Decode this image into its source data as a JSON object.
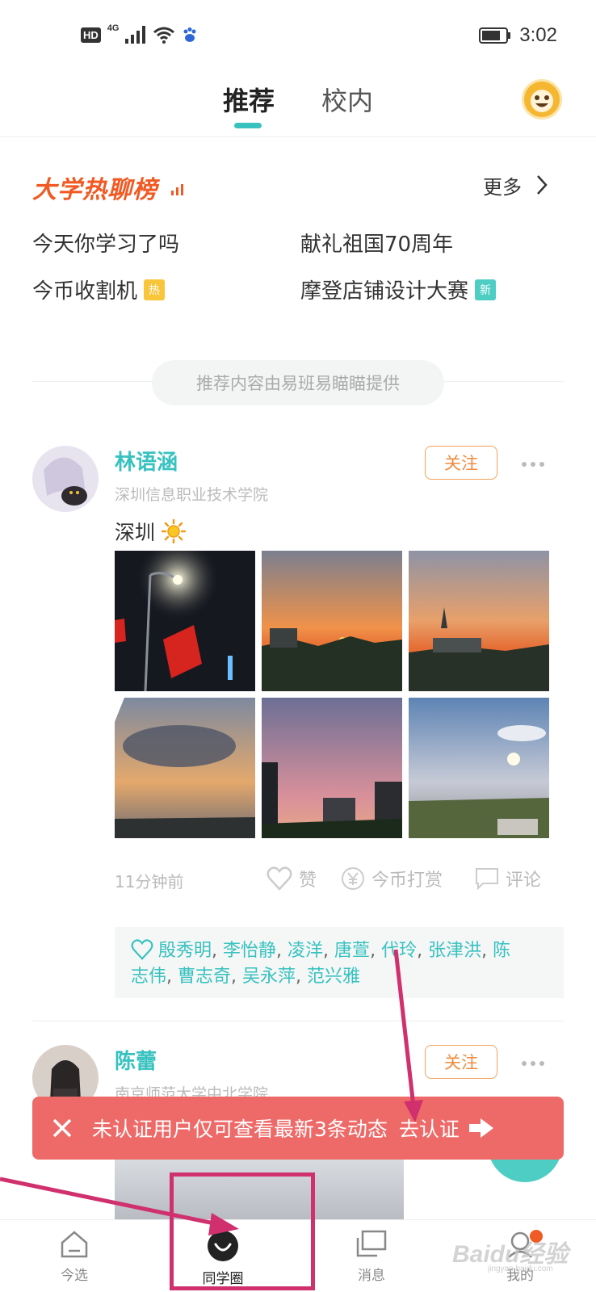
{
  "status_bar": {
    "hd": "HD",
    "network": "4G",
    "time": "3:02"
  },
  "header": {
    "tabs": [
      {
        "label": "推荐",
        "active": true
      },
      {
        "label": "校内",
        "active": false
      }
    ]
  },
  "hot_list": {
    "title": "大学热聊榜",
    "more_label": "更多",
    "items": [
      {
        "label": "今天你学习了吗",
        "badge": ""
      },
      {
        "label": "献礼祖国70周年",
        "badge": ""
      },
      {
        "label": "今币收割机",
        "badge": "热"
      },
      {
        "label": "摩登店铺设计大赛",
        "badge": "新"
      }
    ]
  },
  "provider_note": "推荐内容由易班易瞄瞄提供",
  "posts": [
    {
      "name": "林语涵",
      "school": "深圳信息职业技术学院",
      "follow_label": "关注",
      "text": "深圳",
      "time": "11分钟前",
      "actions": {
        "like": "赞",
        "tip": "今币打赏",
        "comment": "评论"
      },
      "liked_by_line1": [
        "殷秀明",
        "李怡静",
        "凌洋",
        "唐萱",
        "代玲",
        "张津洪",
        "陈"
      ],
      "liked_by_line2": [
        "志伟",
        "曹志奇",
        "吴永萍",
        "范兴雅"
      ]
    },
    {
      "name": "陈蕾",
      "school": "南京师范大学中北学院",
      "follow_label": "关注"
    }
  ],
  "toast": {
    "message": "未认证用户仅可查看最新3条动态",
    "link": "去认证"
  },
  "bottom_nav": [
    {
      "label": "今选",
      "icon": "home-icon"
    },
    {
      "label": "同学圈",
      "icon": "smile-icon",
      "active": true
    },
    {
      "label": "消息",
      "icon": "message-icon"
    },
    {
      "label": "我的",
      "icon": "profile-icon"
    }
  ],
  "watermark": {
    "text": "Baidu经验",
    "sub": "jingyan.baidu.com"
  },
  "colors": {
    "accent": "#37c2c0",
    "hot_title": "#f05a24",
    "follow": "#f08a3c",
    "toast": "#ee6a68",
    "annotation": "#d0306e"
  }
}
